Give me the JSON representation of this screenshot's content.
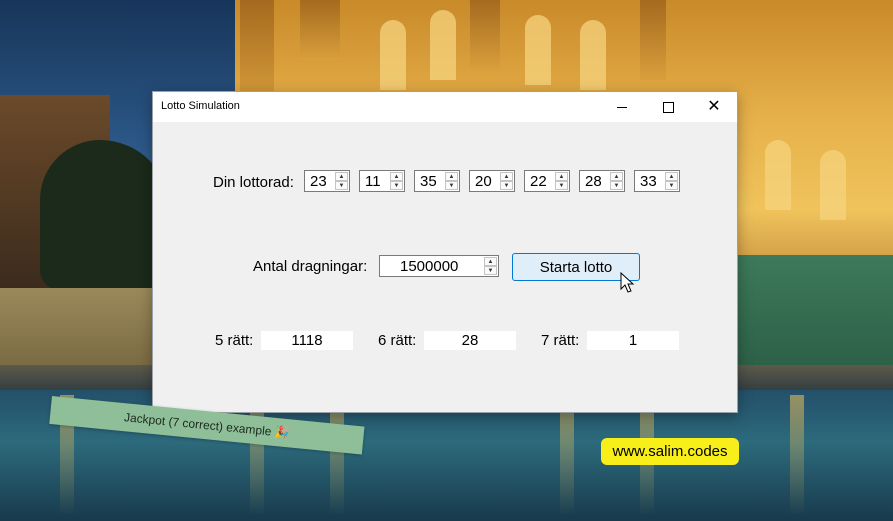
{
  "window": {
    "title": "Lotto Simulation",
    "minimize_icon": "minimize-icon",
    "maximize_icon": "maximize-icon",
    "close_icon": "close-icon",
    "close_glyph": "✕"
  },
  "lottorow": {
    "label": "Din lottorad:",
    "numbers": [
      "23",
      "11",
      "35",
      "20",
      "22",
      "28",
      "33"
    ]
  },
  "draws": {
    "label": "Antal dragningar:",
    "value": "1500000",
    "start_button": "Starta lotto"
  },
  "results": [
    {
      "label": "5 rätt:",
      "value": "1118"
    },
    {
      "label": "6 rätt:",
      "value": "28"
    },
    {
      "label": "7 rätt:",
      "value": "1"
    }
  ],
  "overlay": {
    "tag_text": "Jackpot (7 correct) example 🎉",
    "website": "www.salim.codes"
  },
  "colors": {
    "accent_border": "#0078d4",
    "button_bg": "#e0eef9",
    "window_bg": "#f0f0f0",
    "tag_bg": "#8fbf98",
    "badge_bg": "#f7ee1a"
  }
}
